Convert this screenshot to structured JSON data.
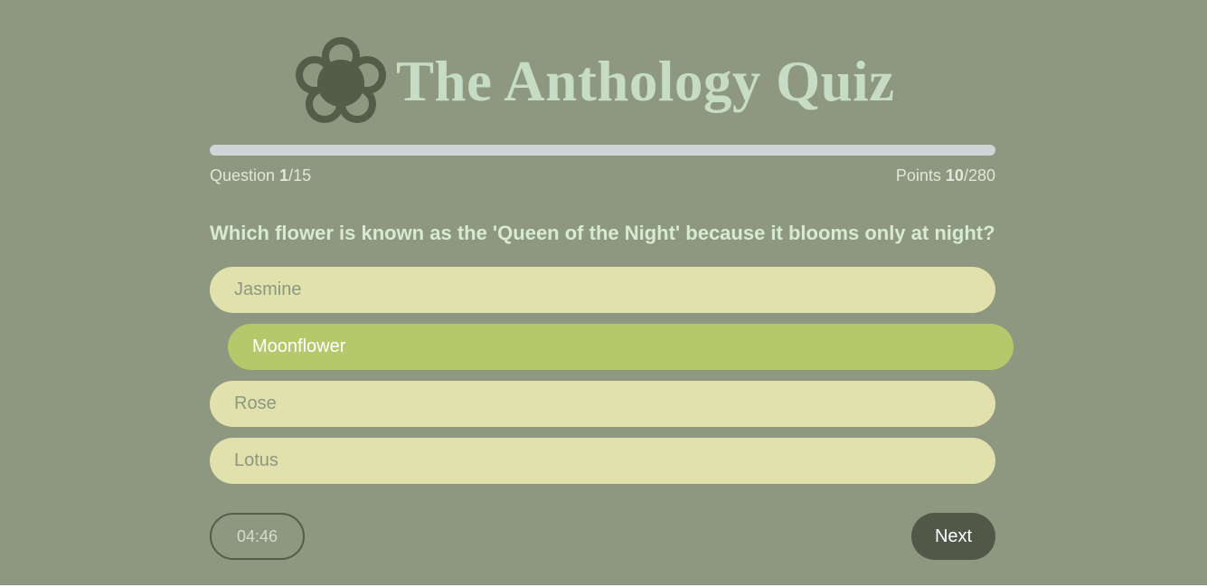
{
  "app": {
    "title": "The Anthology Quiz",
    "logo_icon": "flower-icon"
  },
  "progress": {
    "fraction": 0.0667,
    "question_label": "Question ",
    "question_current": "1",
    "question_total": "/15",
    "points_label": "Points ",
    "points_current": "10",
    "points_total": "/280"
  },
  "question": {
    "text": "Which flower is known as the 'Queen of the Night' because it blooms only at night?"
  },
  "options": [
    {
      "label": "Jasmine",
      "selected": false
    },
    {
      "label": "Moonflower",
      "selected": true
    },
    {
      "label": "Rose",
      "selected": false
    },
    {
      "label": "Lotus",
      "selected": false
    }
  ],
  "footer": {
    "timer": "04:46",
    "next_label": "Next"
  },
  "colors": {
    "background": "#8e977f",
    "title": "#c7dcc4",
    "option": "#e0e1ac",
    "option_selected": "#b5c86b",
    "button_dark": "#515848"
  }
}
